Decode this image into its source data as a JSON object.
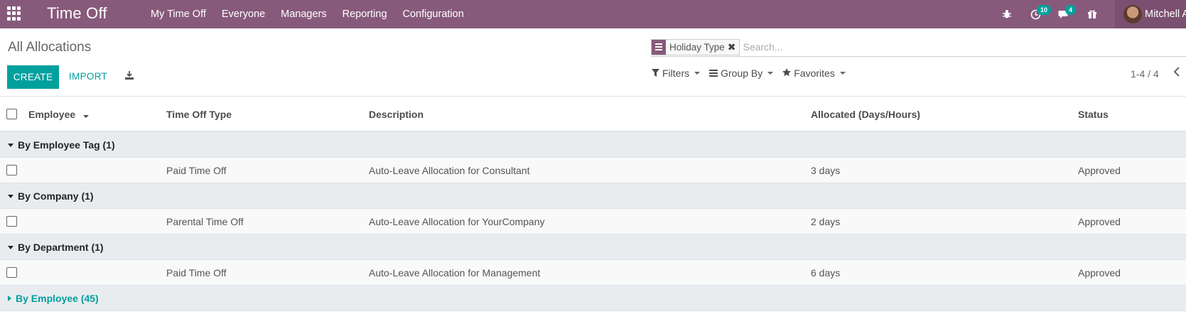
{
  "navbar": {
    "app_title": "Time Off",
    "menu": [
      "My Time Off",
      "Everyone",
      "Managers",
      "Reporting",
      "Configuration"
    ],
    "activity_badge": "10",
    "messages_badge": "4",
    "user_name": "Mitchell Admin",
    "accent_color": "#875a7b"
  },
  "control": {
    "breadcrumb": "All Allocations",
    "create_label": "CREATE",
    "import_label": "IMPORT",
    "facet_label": "Holiday Type",
    "search_placeholder": "Search...",
    "filters_label": "Filters",
    "groupby_label": "Group By",
    "favorites_label": "Favorites",
    "pager": "1-4 / 4",
    "primary_color": "#00a09d"
  },
  "table": {
    "columns": {
      "employee": "Employee",
      "type": "Time Off Type",
      "description": "Description",
      "allocated": "Allocated (Days/Hours)",
      "status": "Status"
    },
    "groups": [
      {
        "label": "By Employee Tag (1)",
        "expanded": true,
        "rows": [
          {
            "type": "Paid Time Off",
            "description": "Auto-Leave Allocation for Consultant",
            "allocated": "3 days",
            "status": "Approved"
          }
        ]
      },
      {
        "label": "By Company (1)",
        "expanded": true,
        "rows": [
          {
            "type": "Parental Time Off",
            "description": "Auto-Leave Allocation for YourCompany",
            "allocated": "2 days",
            "status": "Approved"
          }
        ]
      },
      {
        "label": "By Department (1)",
        "expanded": true,
        "rows": [
          {
            "type": "Paid Time Off",
            "description": "Auto-Leave Allocation for Management",
            "allocated": "6 days",
            "status": "Approved"
          }
        ]
      },
      {
        "label": "By Employee (45)",
        "expanded": false,
        "rows": []
      }
    ]
  }
}
